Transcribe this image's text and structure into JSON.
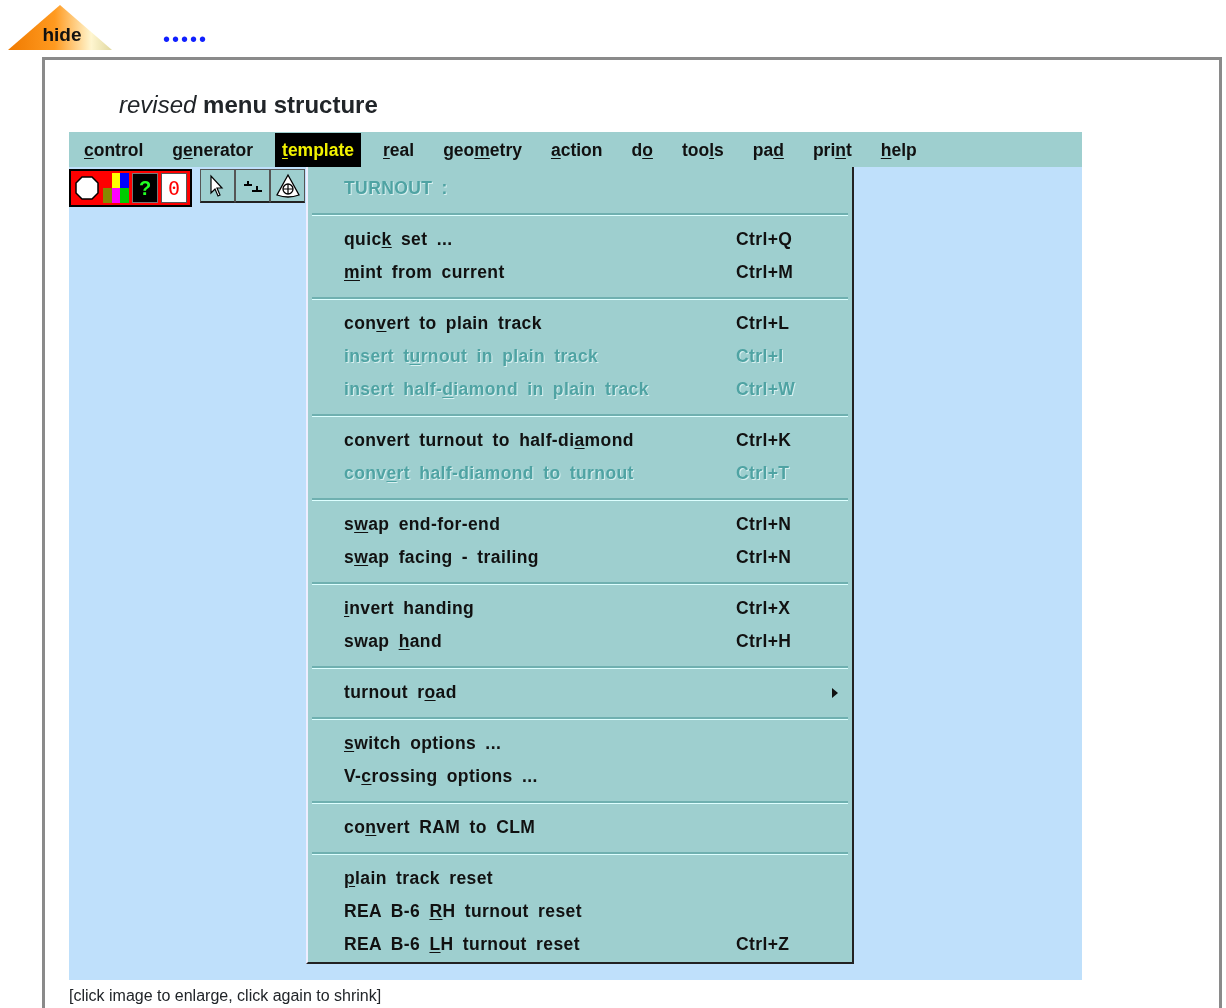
{
  "hide_button": {
    "label": "hide"
  },
  "dots_link": {
    "label": "•••••"
  },
  "heading": "*revised* **menu structure**",
  "menubar": [
    {
      "key": "c",
      "post": "ontrol",
      "selected": false
    },
    {
      "pre": "g",
      "key": "e",
      "post": "nerator",
      "selected": false
    },
    {
      "key": "t",
      "post": "emplate",
      "selected": true
    },
    {
      "key": "r",
      "post": "eal",
      "selected": false
    },
    {
      "pre": "geo",
      "key": "m",
      "post": "etry",
      "selected": false
    },
    {
      "key": "a",
      "post": "ction",
      "selected": false
    },
    {
      "pre": "d",
      "key": "o",
      "selected": false
    },
    {
      "pre": "too",
      "key": "l",
      "post": "s",
      "selected": false
    },
    {
      "pre": "pa",
      "key": "d",
      "selected": false
    },
    {
      "pre": "pri",
      "key": "n",
      "post": "t",
      "selected": false
    },
    {
      "key": "h",
      "post": "elp",
      "selected": false
    }
  ],
  "toolbar": {
    "help_glyph": "?",
    "counter": "0"
  },
  "menu": [
    {
      "kind": "header",
      "pre": "TURNOUT :",
      "disabled": true
    },
    {
      "kind": "separator"
    },
    {
      "kind": "item",
      "pre": "quic",
      "key": "k",
      "post": " set ...",
      "shortcut": "Ctrl+Q",
      "disabled": false
    },
    {
      "kind": "item",
      "key": "m",
      "post": "int from current",
      "shortcut": "Ctrl+M",
      "disabled": false
    },
    {
      "kind": "separator"
    },
    {
      "kind": "item",
      "pre": "con",
      "key": "v",
      "post": "ert to plain track",
      "shortcut": "Ctrl+L",
      "disabled": false
    },
    {
      "kind": "item",
      "pre": "insert t",
      "key": "u",
      "post": "rnout in plain track",
      "shortcut": "Ctrl+I",
      "disabled": true
    },
    {
      "kind": "item",
      "pre": "insert half-",
      "key": "d",
      "post": "iamond in plain track",
      "shortcut": "Ctrl+W",
      "disabled": true
    },
    {
      "kind": "separator"
    },
    {
      "kind": "item",
      "pre": "convert turnout to half-di",
      "key": "a",
      "post": "mond",
      "shortcut": "Ctrl+K",
      "disabled": false
    },
    {
      "kind": "item",
      "pre": "conv",
      "key": "e",
      "post": "rt half-diamond to turnout",
      "shortcut": "Ctrl+T",
      "disabled": true
    },
    {
      "kind": "separator"
    },
    {
      "kind": "item",
      "pre": "s",
      "key": "w",
      "post": "ap end-for-end",
      "shortcut": "Ctrl+N",
      "disabled": false
    },
    {
      "kind": "item",
      "pre": "s",
      "key": "w",
      "post": "ap facing - trailing",
      "shortcut": "Ctrl+N",
      "disabled": false
    },
    {
      "kind": "separator"
    },
    {
      "kind": "item",
      "key": "i",
      "post": "nvert handing",
      "shortcut": "Ctrl+X",
      "disabled": false
    },
    {
      "kind": "item",
      "pre": "swap ",
      "key": "h",
      "post": "and",
      "shortcut": "Ctrl+H",
      "disabled": false
    },
    {
      "kind": "separator"
    },
    {
      "kind": "submenu",
      "pre": "turnout r",
      "key": "o",
      "post": "ad",
      "disabled": false
    },
    {
      "kind": "separator"
    },
    {
      "kind": "item",
      "key": "s",
      "post": "witch options ...",
      "disabled": false
    },
    {
      "kind": "item",
      "pre": "V-",
      "key": "c",
      "post": "rossing options ...",
      "disabled": false
    },
    {
      "kind": "separator"
    },
    {
      "kind": "item",
      "pre": "co",
      "key": "n",
      "post": "vert RAM to CLM",
      "disabled": false
    },
    {
      "kind": "separator"
    },
    {
      "kind": "item",
      "key": "p",
      "post": "lain track reset",
      "disabled": false
    },
    {
      "kind": "item",
      "pre": "REA B-6 ",
      "key": "R",
      "post": "H turnout reset",
      "disabled": false
    },
    {
      "kind": "item",
      "pre": "REA B-6 ",
      "key": "L",
      "post": "H turnout reset",
      "shortcut": "Ctrl+Z",
      "disabled": false
    }
  ],
  "caption": "[click image to enlarge, click again to shrink]"
}
